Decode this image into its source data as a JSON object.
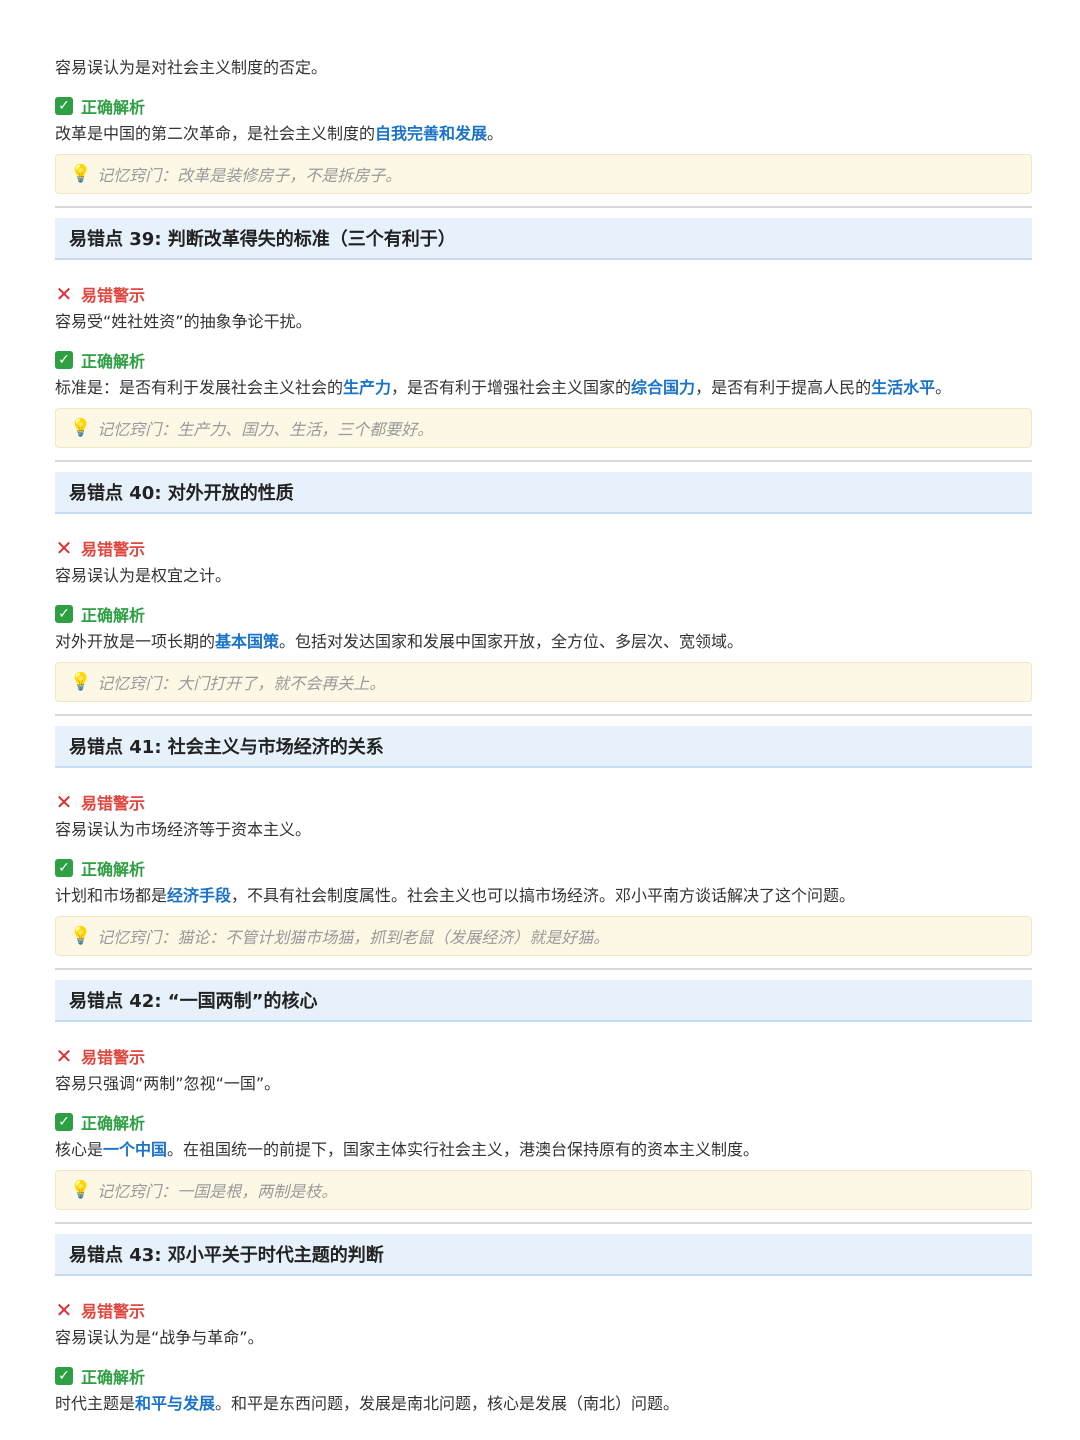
{
  "labels": {
    "correct": "正确解析",
    "warning": "易错警示",
    "memo_prefix": "记忆窍门："
  },
  "icons": {
    "correct": "check-box-icon",
    "warning": "x-mark-icon",
    "memo": "lightbulb-icon"
  },
  "colors": {
    "highlight": "#1a73c9",
    "correct": "#2ea043",
    "warning": "#e0463e",
    "heading_bg": "#e7f1fb",
    "memo_bg": "#fdf8e6"
  },
  "top": {
    "mistake_tail": "容易误认为是对社会主义制度的否定。",
    "correct_pre": "改革是中国的第二次革命，是社会主义制度的",
    "correct_hl": "自我完善和发展",
    "correct_post": "。",
    "memo": "改革是装修房子，不是拆房子。"
  },
  "sections": [
    {
      "title": "易错点 39: 判断改革得失的标准（三个有利于）",
      "mistake": "容易受“姓社姓资”的抽象争论干扰。",
      "correct_segments": [
        {
          "t": "标准是：是否有利于发展社会主义社会的",
          "h": false
        },
        {
          "t": "生产力",
          "h": true
        },
        {
          "t": "，是否有利于增强社会主义国家的",
          "h": false
        },
        {
          "t": "综合国力",
          "h": true
        },
        {
          "t": "，是否有利于提高人民的",
          "h": false
        },
        {
          "t": "生活水平",
          "h": true
        },
        {
          "t": "。",
          "h": false
        }
      ],
      "memo": "生产力、国力、生活，三个都要好。"
    },
    {
      "title": "易错点 40: 对外开放的性质",
      "mistake": "容易误认为是权宜之计。",
      "correct_segments": [
        {
          "t": "对外开放是一项长期的",
          "h": false
        },
        {
          "t": "基本国策",
          "h": true
        },
        {
          "t": "。包括对发达国家和发展中国家开放，全方位、多层次、宽领域。",
          "h": false
        }
      ],
      "memo": "大门打开了，就不会再关上。"
    },
    {
      "title": "易错点 41: 社会主义与市场经济的关系",
      "mistake": "容易误认为市场经济等于资本主义。",
      "correct_segments": [
        {
          "t": "计划和市场都是",
          "h": false
        },
        {
          "t": "经济手段",
          "h": true
        },
        {
          "t": "，不具有社会制度属性。社会主义也可以搞市场经济。邓小平南方谈话解决了这个问题。",
          "h": false
        }
      ],
      "memo": "猫论：不管计划猫市场猫，抓到老鼠（发展经济）就是好猫。"
    },
    {
      "title": "易错点 42: “一国两制”的核心",
      "mistake": "容易只强调“两制”忽视“一国”。",
      "correct_segments": [
        {
          "t": "核心是",
          "h": false
        },
        {
          "t": "一个中国",
          "h": true
        },
        {
          "t": "。在祖国统一的前提下，国家主体实行社会主义，港澳台保持原有的资本主义制度。",
          "h": false
        }
      ],
      "memo": "一国是根，两制是枝。"
    },
    {
      "title": "易错点 43: 邓小平关于时代主题的判断",
      "mistake": "容易误认为是“战争与革命”。",
      "correct_segments": [
        {
          "t": "时代主题是",
          "h": false
        },
        {
          "t": "和平与发展",
          "h": true
        },
        {
          "t": "。和平是东西问题，发展是南北问题，核心是发展（南北）问题。",
          "h": false
        }
      ],
      "memo": ""
    }
  ]
}
